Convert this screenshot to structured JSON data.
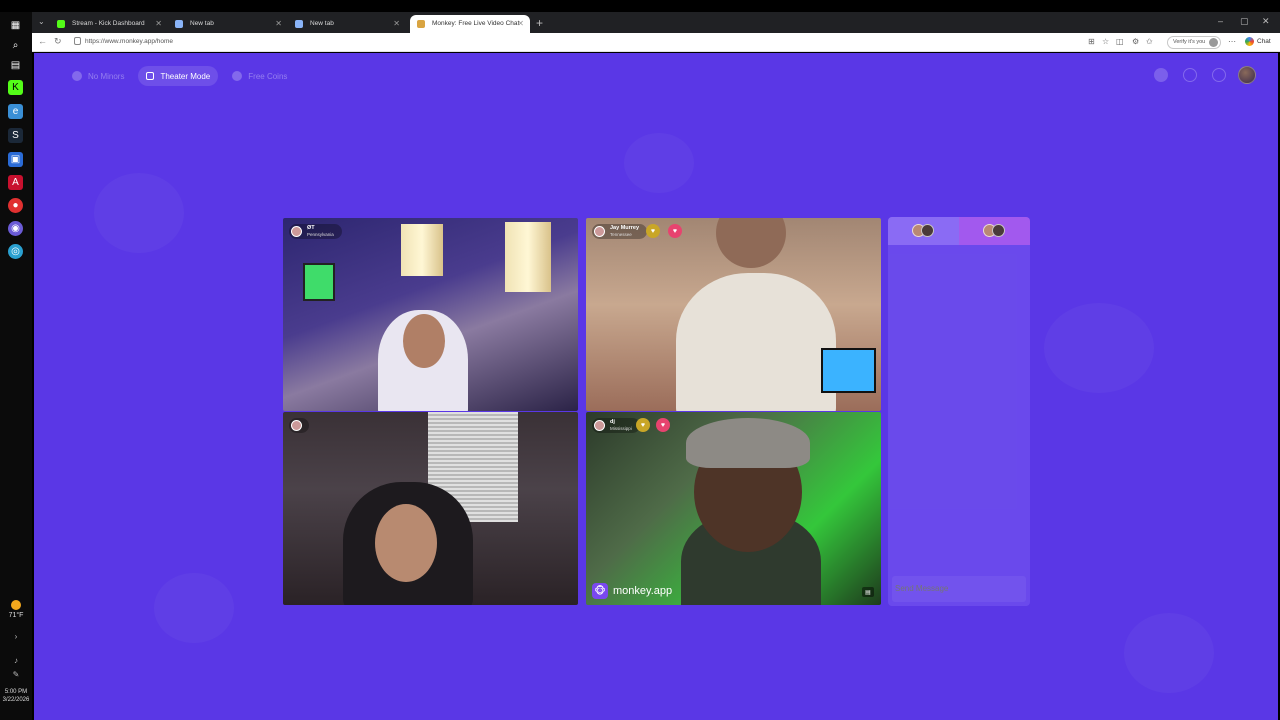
{
  "browser": {
    "tabs": [
      {
        "title": "Stream - Kick Dashboard",
        "favicon_color": "#53fc18"
      },
      {
        "title": "New tab",
        "favicon_color": "#8ab4f8"
      },
      {
        "title": "New tab",
        "favicon_color": "#8ab4f8"
      },
      {
        "title": "Monkey: Free Live Video Chat",
        "favicon_color": "#d9a441"
      }
    ],
    "url": "https://www.monkey.app/home",
    "verify_label": "Verify it's you",
    "chat_label": "Chat"
  },
  "taskbar": {
    "temperature": "71°F",
    "time": "5:00 PM",
    "date": "3/22/2026"
  },
  "page": {
    "accent": "#5a37e6",
    "top_left_pills": [
      {
        "label": "No Minors",
        "active": false
      },
      {
        "label": "Theater Mode",
        "active": true
      },
      {
        "label": "Free Coins",
        "active": false
      }
    ],
    "tiles": [
      {
        "name": "ØT",
        "location": "Pennsylvania"
      },
      {
        "name": "Jay Murrey",
        "location": "Tennessee"
      },
      {
        "name": "",
        "location": ""
      },
      {
        "name": "dj",
        "location": "Mississippi"
      }
    ],
    "brand": "monkey.app",
    "chat": {
      "placeholder": "Send Message"
    }
  }
}
